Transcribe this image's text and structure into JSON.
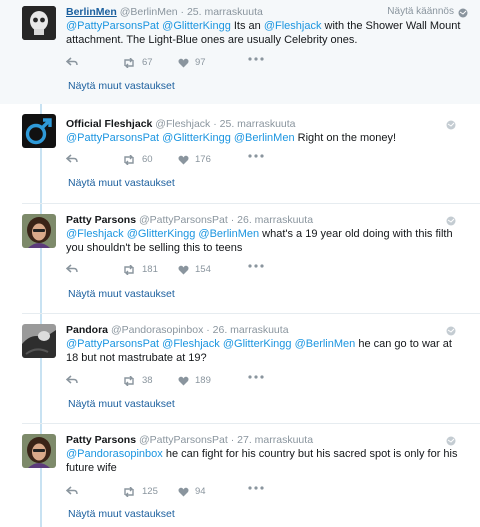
{
  "translate_label": "Näytä käännös",
  "more_replies_label": "Näytä muut vastaukset",
  "tweets": [
    {
      "name": "BerlinMen",
      "handle": "@BerlinMen",
      "date": "· 25. marraskuuta",
      "text": [
        {
          "t": "@PattyParsonsPat",
          "m": true
        },
        {
          "t": " ",
          "m": false
        },
        {
          "t": "@GlitterKingg",
          "m": true
        },
        {
          "t": " Its an ",
          "m": false
        },
        {
          "t": "@Fleshjack",
          "m": true
        },
        {
          "t": " with the Shower Wall Mount attachment. The Light-Blue ones are usually Celebrity ones.",
          "m": false
        }
      ],
      "retweets": "67",
      "likes": "97",
      "avatar": "skull-portrait"
    },
    {
      "name": "Official Fleshjack",
      "handle": "@Fleshjack",
      "date": "· 25. marraskuuta",
      "text": [
        {
          "t": "@PattyParsonsPat",
          "m": true
        },
        {
          "t": " ",
          "m": false
        },
        {
          "t": "@GlitterKingg",
          "m": true
        },
        {
          "t": " ",
          "m": false
        },
        {
          "t": "@BerlinMen",
          "m": true
        },
        {
          "t": " Right on the money!",
          "m": false
        }
      ],
      "retweets": "60",
      "likes": "176",
      "avatar": "fleshjack-logo"
    },
    {
      "name": "Patty Parsons",
      "handle": "@PattyParsonsPat",
      "date": "· 26. marraskuuta",
      "text": [
        {
          "t": "@Fleshjack",
          "m": true
        },
        {
          "t": " ",
          "m": false
        },
        {
          "t": "@GlitterKingg",
          "m": true
        },
        {
          "t": " ",
          "m": false
        },
        {
          "t": "@BerlinMen",
          "m": true
        },
        {
          "t": " what's a 19 year old doing with this filth you shouldn't be selling this to teens",
          "m": false
        }
      ],
      "retweets": "181",
      "likes": "154",
      "avatar": "woman-portrait"
    },
    {
      "name": "Pandora",
      "handle": "@Pandorasopinbox",
      "date": "· 26. marraskuuta",
      "text": [
        {
          "t": "@PattyParsonsPat",
          "m": true
        },
        {
          "t": " ",
          "m": false
        },
        {
          "t": "@Fleshjack",
          "m": true
        },
        {
          "t": " ",
          "m": false
        },
        {
          "t": "@GlitterKingg",
          "m": true
        },
        {
          "t": " ",
          "m": false
        },
        {
          "t": "@BerlinMen",
          "m": true
        },
        {
          "t": " he can go to war at 18 but not mastrubate at 19?",
          "m": false
        }
      ],
      "retweets": "38",
      "likes": "189",
      "avatar": "bw-portrait"
    },
    {
      "name": "Patty Parsons",
      "handle": "@PattyParsonsPat",
      "date": "· 27. marraskuuta",
      "text": [
        {
          "t": "@Pandorasopinbox",
          "m": true
        },
        {
          "t": " he can fight for his country but his sacred spot is only for his future wife",
          "m": false
        }
      ],
      "retweets": "125",
      "likes": "94",
      "avatar": "woman-portrait"
    }
  ],
  "colors": {
    "mention": "#1b95e0",
    "link": "#1b5f9e",
    "meta": "#8a959e",
    "thread_line": "#c8e2f2",
    "highlight_bg": "#f5f8fa"
  }
}
